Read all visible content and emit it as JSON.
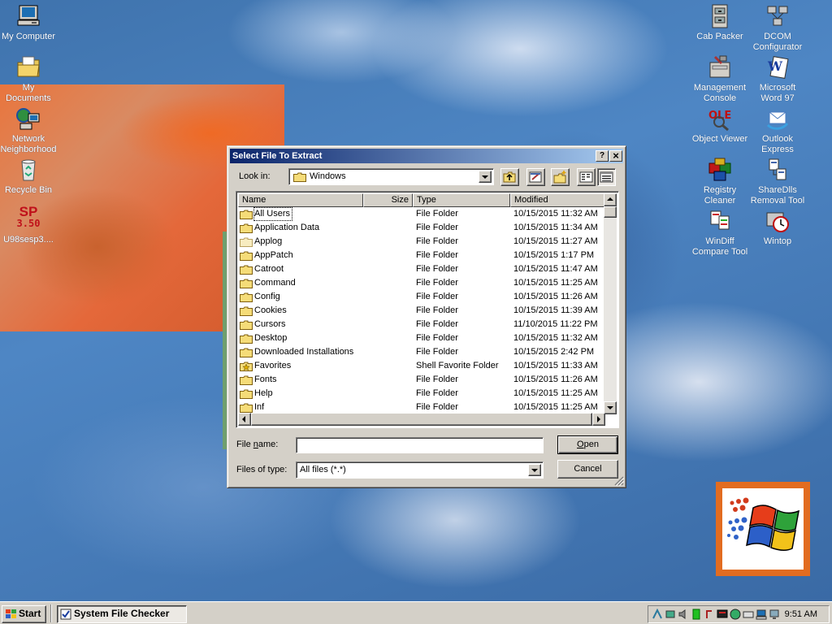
{
  "desktop": {
    "icons_left": [
      {
        "label": "My Computer",
        "icon": "my-computer-icon"
      },
      {
        "label": "My\nDocuments",
        "icon": "my-documents-icon"
      },
      {
        "label": "Network\nNeighborhood",
        "icon": "network-neighborhood-icon"
      },
      {
        "label": "Recycle Bin",
        "icon": "recycle-bin-icon"
      },
      {
        "label": "U98sesp3....",
        "icon": "sp-350-icon",
        "icon_text_top": "SP",
        "icon_text_bottom": "3.50"
      }
    ],
    "icons_right": [
      {
        "label": "Cab Packer",
        "icon": "cab-packer-icon"
      },
      {
        "label": "DCOM\nConfigurator",
        "icon": "dcom-configurator-icon"
      },
      {
        "label": "Management\nConsole",
        "icon": "management-console-icon"
      },
      {
        "label": "Microsoft\nWord 97",
        "icon": "word-icon"
      },
      {
        "label": "Object Viewer",
        "icon": "ole-object-viewer-icon",
        "icon_text": "OLE"
      },
      {
        "label": "Outlook\nExpress",
        "icon": "outlook-express-icon"
      },
      {
        "label": "Registry\nCleaner",
        "icon": "registry-cleaner-icon"
      },
      {
        "label": "ShareDlls\nRemoval Tool",
        "icon": "sharedlls-icon"
      },
      {
        "label": "WinDiff\nCompare Tool",
        "icon": "windiff-icon"
      },
      {
        "label": "Wintop",
        "icon": "wintop-icon"
      }
    ]
  },
  "dialog": {
    "title": "Select File To Extract",
    "help_button": "?",
    "close_button": "×",
    "look_in_label": "Look in:",
    "look_in_value": "Windows",
    "toolbar_icons": [
      "up-one-level-icon",
      "desktop-icon",
      "new-folder-icon",
      "list-view-icon",
      "details-view-icon"
    ],
    "columns": [
      "Name",
      "Size",
      "Type",
      "Modified"
    ],
    "rows": [
      {
        "name": "All Users",
        "size": "",
        "type": "File Folder",
        "modified": "10/15/2015 11:32 AM",
        "icon": "folder-icon"
      },
      {
        "name": "Application Data",
        "size": "",
        "type": "File Folder",
        "modified": "10/15/2015 11:34 AM",
        "icon": "folder-icon"
      },
      {
        "name": "Applog",
        "size": "",
        "type": "File Folder",
        "modified": "10/15/2015 11:27 AM",
        "icon": "hidden-folder-icon"
      },
      {
        "name": "AppPatch",
        "size": "",
        "type": "File Folder",
        "modified": "10/15/2015 1:17 PM",
        "icon": "folder-icon"
      },
      {
        "name": "Catroot",
        "size": "",
        "type": "File Folder",
        "modified": "10/15/2015 11:47 AM",
        "icon": "folder-icon"
      },
      {
        "name": "Command",
        "size": "",
        "type": "File Folder",
        "modified": "10/15/2015 11:25 AM",
        "icon": "folder-icon"
      },
      {
        "name": "Config",
        "size": "",
        "type": "File Folder",
        "modified": "10/15/2015 11:26 AM",
        "icon": "folder-icon"
      },
      {
        "name": "Cookies",
        "size": "",
        "type": "File Folder",
        "modified": "10/15/2015 11:39 AM",
        "icon": "folder-icon"
      },
      {
        "name": "Cursors",
        "size": "",
        "type": "File Folder",
        "modified": "11/10/2015 11:22 PM",
        "icon": "folder-icon"
      },
      {
        "name": "Desktop",
        "size": "",
        "type": "File Folder",
        "modified": "10/15/2015 11:32 AM",
        "icon": "folder-icon"
      },
      {
        "name": "Downloaded Installations",
        "size": "",
        "type": "File Folder",
        "modified": "10/15/2015 2:42 PM",
        "icon": "folder-icon"
      },
      {
        "name": "Favorites",
        "size": "",
        "type": "Shell Favorite Folder",
        "modified": "10/15/2015 11:33 AM",
        "icon": "favorites-folder-icon"
      },
      {
        "name": "Fonts",
        "size": "",
        "type": "File Folder",
        "modified": "10/15/2015 11:26 AM",
        "icon": "folder-icon"
      },
      {
        "name": "Help",
        "size": "",
        "type": "File Folder",
        "modified": "10/15/2015 11:25 AM",
        "icon": "folder-icon"
      },
      {
        "name": "Inf",
        "size": "",
        "type": "File Folder",
        "modified": "10/15/2015 11:25 AM",
        "icon": "folder-icon"
      }
    ],
    "file_name_label": "File name:",
    "file_name_value": "",
    "files_of_type_label": "Files of type:",
    "files_of_type_value": "All files (*.*)",
    "open_button": "Open",
    "cancel_button": "Cancel"
  },
  "taskbar": {
    "start_label": "Start",
    "task_item": "System File Checker",
    "clock": "9:51 AM",
    "tray_icons": [
      "network-icon",
      "recycle-icon",
      "volume-icon",
      "green-status-icon",
      "java-icon",
      "monitor-icon",
      "globe-icon",
      "keyboard-icon",
      "computer-icon",
      "display-icon"
    ]
  },
  "colors": {
    "title_active_start": "#0a246a",
    "title_active_end": "#a6caf0",
    "face": "#d4d0c8",
    "desktop": "#3c6ea8"
  }
}
